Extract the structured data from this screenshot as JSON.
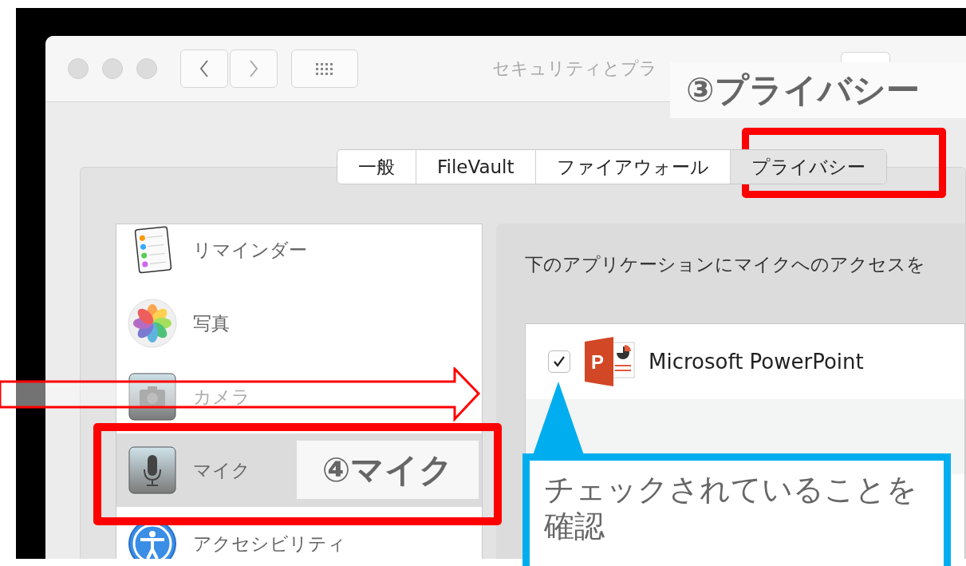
{
  "window": {
    "title": "セキュリティとプラ"
  },
  "tabs": [
    {
      "label": "一般",
      "selected": false
    },
    {
      "label": "FileVault",
      "selected": false
    },
    {
      "label": "ファイアウォール",
      "selected": false
    },
    {
      "label": "プライバシー",
      "selected": true
    }
  ],
  "sidebar": {
    "items": [
      {
        "label": "リマインダー",
        "kind": "reminders",
        "selected": false
      },
      {
        "label": "写真",
        "kind": "photos",
        "selected": false
      },
      {
        "label": "カメラ",
        "kind": "camera",
        "selected": false
      },
      {
        "label": "マイク",
        "kind": "microphone",
        "selected": true
      },
      {
        "label": "アクセシビリティ",
        "kind": "accessibility",
        "selected": false
      }
    ]
  },
  "panel": {
    "description": "下のアプリケーションにマイクへのアクセスを",
    "apps": [
      {
        "name": "Microsoft PowerPoint",
        "icon_letter": "P",
        "checked": true
      }
    ]
  },
  "annotations": {
    "privacy_label": "③プライバシー",
    "mic_label": "④マイク",
    "check_note": "チェックされていることを確認"
  }
}
